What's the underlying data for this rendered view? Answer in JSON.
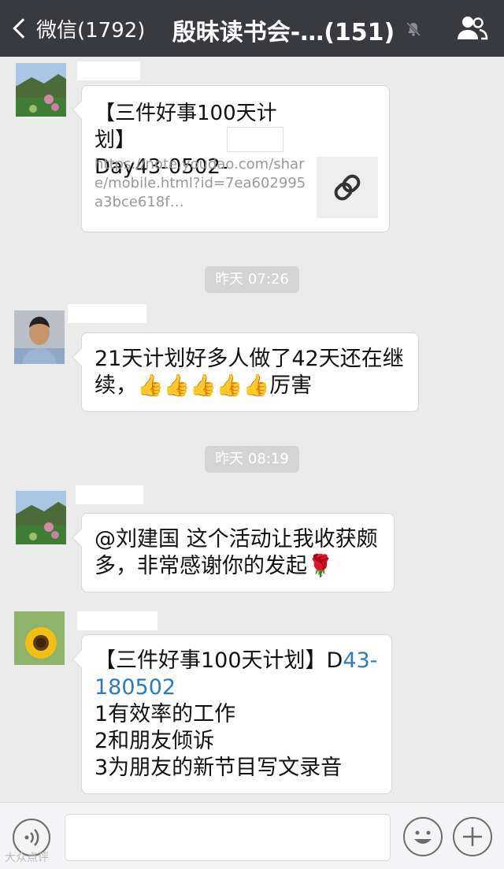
{
  "header": {
    "back_label": "微信(1792)",
    "title": "殷昧读书会-…(151)",
    "mute_icon": "muted-bell-icon",
    "members_icon": "people-icon"
  },
  "messages": [
    {
      "type": "link",
      "title_line1": "【三件好事100天计划】",
      "title_line2": "Day43-0502-",
      "url": "https://note.youdao.com/share/mobile.html?id=7ea602995a3bce618f…",
      "thumb_icon": "link-icon"
    },
    {
      "type": "time",
      "text": "昨天 07:26"
    },
    {
      "type": "text",
      "line1": "21天计划好多人做了42天还在继",
      "line2_prefix": "续，",
      "emojis": "👍👍👍👍👍",
      "line2_suffix": "厉害"
    },
    {
      "type": "time",
      "text": "昨天 08:19"
    },
    {
      "type": "text",
      "line1": "@刘建国 这个活动让我收获颇",
      "line2": "多，非常感谢你的发起",
      "emoji": "🌹"
    },
    {
      "type": "text",
      "line1_prefix": "【三件好事100天计划】D",
      "line1_link": "43-",
      "line2_link": "180502",
      "line3": "1有效率的工作",
      "line4": "2和朋友倾诉",
      "line5": "3为朋友的新节目写文录音"
    }
  ],
  "inputbar": {
    "voice_icon": "voice-icon",
    "emoji_icon": "emoji-icon",
    "plus_icon": "plus-icon"
  },
  "watermark": "大众点评"
}
